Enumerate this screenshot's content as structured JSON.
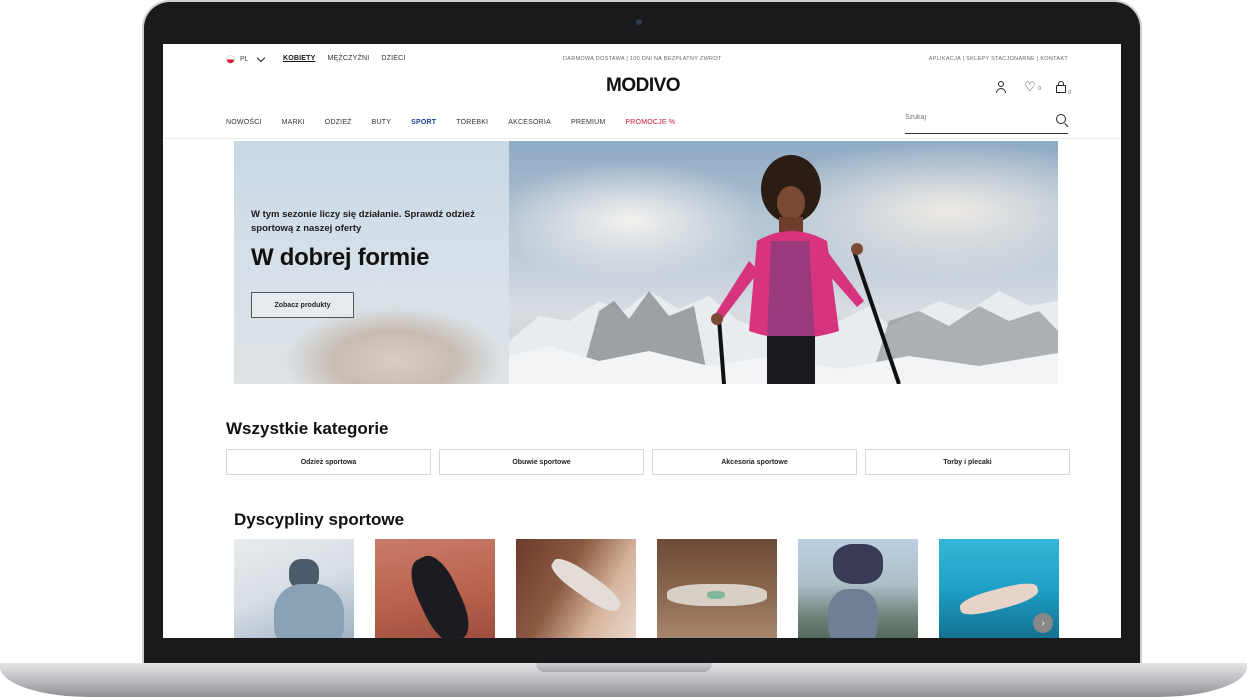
{
  "header": {
    "language": "PL",
    "gender_tabs": [
      "KOBIETY",
      "MĘŻCZYŹNI",
      "DZIECI"
    ],
    "promo_text": "DARMOWA DOSTAWA | 100 DNI NA BEZPŁATNY ZWROT",
    "service_links": "APLIKACJA | SKLEPY STACJONARNE | KONTAKT",
    "logo": "MODIVO",
    "wishlist_count": "0",
    "cart_count": "0"
  },
  "nav": {
    "items": [
      "NOWOŚCI",
      "MARKI",
      "ODZIEŻ",
      "BUTY",
      "SPORT",
      "TOREBKI",
      "AKCESORIA",
      "PREMIUM",
      "PROMOCJE %"
    ],
    "active": "SPORT"
  },
  "search": {
    "placeholder": "Szukaj"
  },
  "hero": {
    "subtitle": "W tym sezonie liczy się działanie. Sprawdź odzież sportową z naszej oferty",
    "title": "W dobrej formie",
    "button": "Zobacz produkty"
  },
  "categories": {
    "title": "Wszystkie kategorie",
    "items": [
      "Odzież sportowa",
      "Obuwie sportowe",
      "Akcesoria sportowe",
      "Torby i plecaki"
    ]
  },
  "disciplines": {
    "title": "Dyscypliny sportowe"
  },
  "colors": {
    "sport_active": "#1a3d9e",
    "promo_red": "#c5163a",
    "jacket_pink": "#d8337f"
  }
}
